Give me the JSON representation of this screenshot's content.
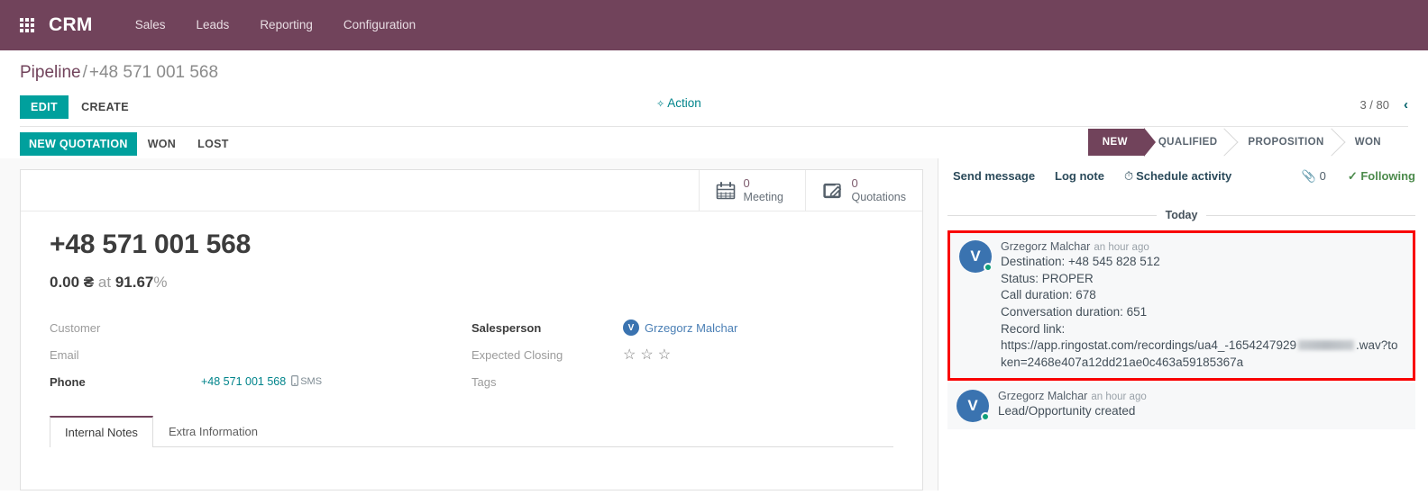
{
  "navbar": {
    "apps_icon": "apps-grid-icon",
    "brand": "CRM",
    "items": [
      {
        "label": "Sales"
      },
      {
        "label": "Leads"
      },
      {
        "label": "Reporting"
      },
      {
        "label": "Configuration"
      }
    ]
  },
  "breadcrumb": {
    "root": "Pipeline",
    "separator": "/",
    "current": "+48 571 001 568"
  },
  "control_panel": {
    "edit_label": "EDIT",
    "create_label": "CREATE",
    "action_label": "Action",
    "action_icon": "gear-icon",
    "pager_value": "3 / 80",
    "pager_prev_icon": "chevron-left-icon"
  },
  "status_row": {
    "new_quotation_label": "NEW QUOTATION",
    "won_label": "WON",
    "lost_label": "LOST",
    "stages": [
      {
        "label": "NEW",
        "active": true
      },
      {
        "label": "QUALIFIED",
        "active": false
      },
      {
        "label": "PROPOSITION",
        "active": false
      },
      {
        "label": "WON",
        "active": false
      }
    ]
  },
  "smart_buttons": [
    {
      "value": "0",
      "label": "Meeting",
      "icon": "calendar-icon"
    },
    {
      "value": "0",
      "label": "Quotations",
      "icon": "quotation-edit-icon"
    }
  ],
  "record": {
    "title": "+48 571 001 568",
    "revenue": "0.00 ₴",
    "at_label": "at",
    "probability": "91.67",
    "percent_symbol": "%"
  },
  "fields_left": [
    {
      "label": "Customer",
      "value": "",
      "filled": false
    },
    {
      "label": "Email",
      "value": "",
      "filled": false
    },
    {
      "label": "Phone",
      "value": "+48 571 001 568",
      "filled": true,
      "sms_label": "SMS",
      "sms_icon": "mobile-icon"
    }
  ],
  "fields_right": {
    "salesperson": {
      "label": "Salesperson",
      "avatar_initial": "V",
      "name": "Grzegorz Malchar"
    },
    "expected_closing": {
      "label": "Expected Closing",
      "stars": [
        "☆",
        "☆",
        "☆"
      ]
    },
    "tags": {
      "label": "Tags",
      "value": ""
    }
  },
  "notebook": {
    "tabs": [
      {
        "label": "Internal Notes",
        "active": true
      },
      {
        "label": "Extra Information",
        "active": false
      }
    ]
  },
  "chatter": {
    "send_message": "Send message",
    "log_note": "Log note",
    "schedule_activity": "Schedule activity",
    "schedule_icon": "clock-icon",
    "attachment_icon": "paperclip-icon",
    "attachment_count": "0",
    "follow_icon": "check-icon",
    "follow_label": "Following",
    "day_separator": "Today",
    "messages": [
      {
        "highlighted": true,
        "avatar_initial": "V",
        "author": "Grzegorz Malchar",
        "time": "an hour ago",
        "lines": [
          "Destination:  +48 545 828 512",
          "Status: PROPER",
          "Call duration: 678",
          "Conversation duration: 651",
          "Record link:"
        ],
        "link_prefix": "https://app.ringostat.com/recordings/ua4_-1654247929",
        "link_redacted": true,
        "link_suffix": ".wav?token=2468e407a12dd21ae0c463a59185367a"
      },
      {
        "highlighted": false,
        "avatar_initial": "V",
        "author": "Grzegorz Malchar",
        "time": "an hour ago",
        "lines": [
          "Lead/Opportunity created"
        ]
      }
    ]
  },
  "colors": {
    "brand_purple": "#71435b",
    "teal": "#00a09d",
    "link_teal": "#00848b",
    "avatar_blue": "#3a73b0",
    "highlight_red": "#f90000",
    "following_green": "#4c8b4c"
  }
}
